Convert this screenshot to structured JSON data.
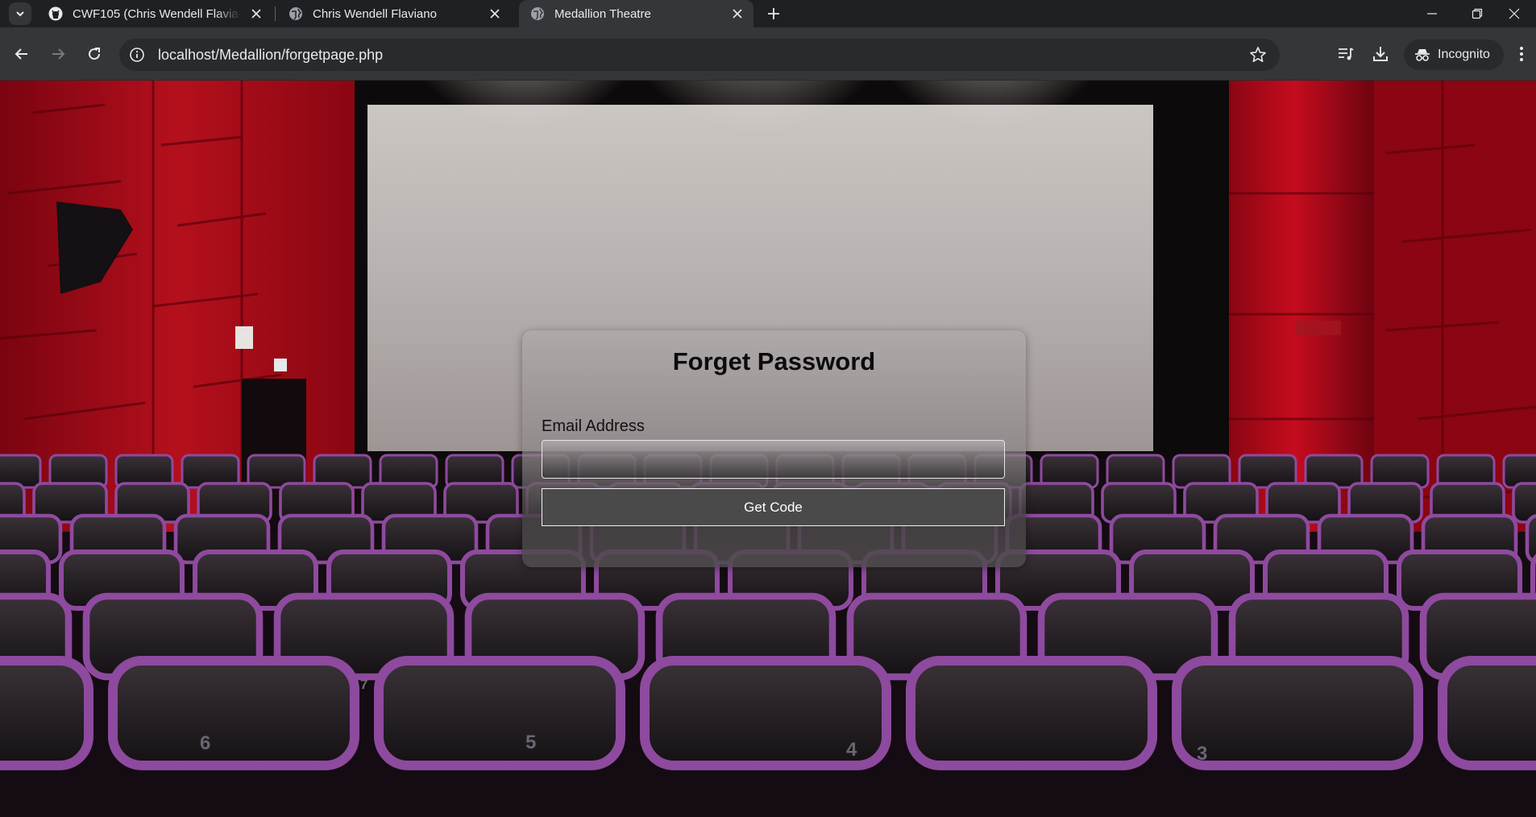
{
  "browser": {
    "tabs": [
      {
        "title": "CWF105 (Chris Wendell Flaviano",
        "icon": "github-icon"
      },
      {
        "title": "Chris Wendell Flaviano",
        "icon": "globe-icon"
      },
      {
        "title": "Medallion Theatre",
        "icon": "globe-icon",
        "active": true
      }
    ],
    "url": "localhost/Medallion/forgetpage.php",
    "profile_label": "Incognito"
  },
  "form": {
    "title": "Forget Password",
    "email_label": "Email Address",
    "email_value": "",
    "submit_label": "Get Code"
  },
  "seats": {
    "numbers": [
      "7",
      "6",
      "5",
      "4",
      "3"
    ]
  },
  "colors": {
    "wall_red": "#a8000f",
    "seat_purple": "#8e4a9e",
    "button_bg": "#4a4a4a"
  }
}
